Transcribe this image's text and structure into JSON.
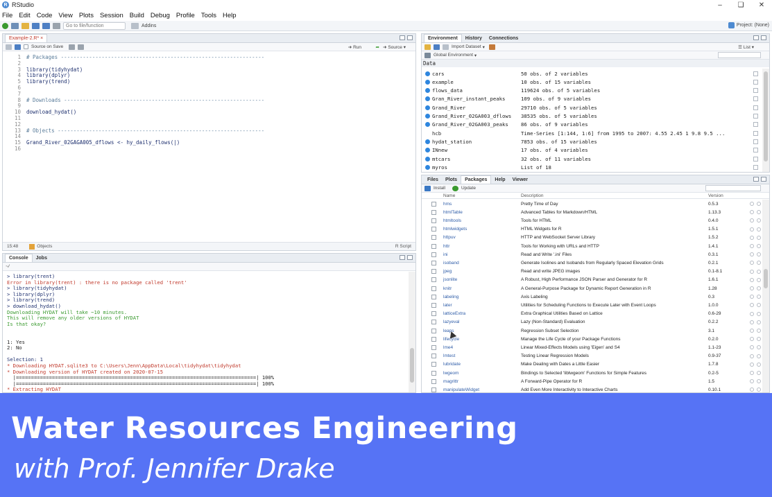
{
  "window": {
    "title": "RStudio",
    "app_initial": "R"
  },
  "menu": [
    "File",
    "Edit",
    "Code",
    "View",
    "Plots",
    "Session",
    "Build",
    "Debug",
    "Profile",
    "Tools",
    "Help"
  ],
  "toolbar": {
    "goto_placeholder": "Go to file/function",
    "addins": "Addins",
    "project": "Project: (None)"
  },
  "editor": {
    "tab": "Example-2.R*",
    "source_on_save": "Source on Save",
    "run": "Run",
    "source": "Source",
    "lines": [
      {
        "n": "1",
        "text": "# Packages -----------------------------------------------------------------",
        "kind": "comment"
      },
      {
        "n": "2",
        "text": "",
        "kind": "code"
      },
      {
        "n": "3",
        "text": "library(tidyhydat)",
        "kind": "code"
      },
      {
        "n": "4",
        "text": "library(dplyr)",
        "kind": "code"
      },
      {
        "n": "5",
        "text": "library(trend)",
        "kind": "code"
      },
      {
        "n": "6",
        "text": "",
        "kind": "code"
      },
      {
        "n": "7",
        "text": "",
        "kind": "code"
      },
      {
        "n": "8",
        "text": "# Downloads ----------------------------------------------------------------",
        "kind": "comment"
      },
      {
        "n": "9",
        "text": "",
        "kind": "code"
      },
      {
        "n": "10",
        "text": "download_hydat()",
        "kind": "code"
      },
      {
        "n": "11",
        "text": "",
        "kind": "code"
      },
      {
        "n": "12",
        "text": "",
        "kind": "code"
      },
      {
        "n": "13",
        "text": "# Objects ------------------------------------------------------------------",
        "kind": "comment"
      },
      {
        "n": "14",
        "text": "",
        "kind": "code"
      },
      {
        "n": "15",
        "text": "Grand_River_02GAGA005_dflows <- hy_daily_flows(|)",
        "kind": "code"
      },
      {
        "n": "16",
        "text": "",
        "kind": "code"
      }
    ],
    "status_pos": "15:48",
    "status_scope": "Objects",
    "status_type": "R Script"
  },
  "console": {
    "tabs": [
      "Console",
      "Jobs"
    ],
    "path": "~/",
    "lines": [
      {
        "text": "> library(trent)",
        "kind": "cmd"
      },
      {
        "text": "Error in library(trent) : there is no package called 'trent'",
        "kind": "err"
      },
      {
        "text": "> library(tidyhydat)",
        "kind": "cmd"
      },
      {
        "text": "> library(dplyr)",
        "kind": "cmd"
      },
      {
        "text": "> library(trend)",
        "kind": "cmd"
      },
      {
        "text": "> download_hydat()",
        "kind": "cmd"
      },
      {
        "text": "Downloading HYDAT will take ~10 minutes.",
        "kind": "msg"
      },
      {
        "text": "This will remove any older versions of HYDAT",
        "kind": "msg"
      },
      {
        "text": "Is that okay?",
        "kind": "msg"
      },
      {
        "text": "",
        "kind": "out"
      },
      {
        "text": "",
        "kind": "out"
      },
      {
        "text": "1: Yes",
        "kind": "out"
      },
      {
        "text": "2: No",
        "kind": "out"
      },
      {
        "text": "",
        "kind": "out"
      },
      {
        "text": "Selection: 1",
        "kind": "cmd"
      },
      {
        "text": "* Downloading HYDAT.sqlite3 to C:\\Users\\Jenn\\AppData\\Local\\tidyhydat\\tidyhydat",
        "kind": "info"
      },
      {
        "text": "* Downloading version of HYDAT created on 2020-07-15",
        "kind": "info"
      },
      {
        "text": "  |================================================================================| 100%",
        "kind": "out"
      },
      {
        "text": "  |================================================================================| 100%",
        "kind": "out"
      },
      {
        "text": "* Extracting HYDAT",
        "kind": "info"
      }
    ]
  },
  "environment": {
    "tabs": [
      "Environment",
      "History",
      "Connections"
    ],
    "import": "Import Dataset",
    "scope": "Global Environment",
    "list_view": "List",
    "section": "Data",
    "rows": [
      {
        "name": "cars",
        "value": "50 obs. of 2 variables",
        "icon": true
      },
      {
        "name": "example",
        "value": "10 obs. of 15 variables",
        "icon": true
      },
      {
        "name": "flows_data",
        "value": "119624 obs. of 5 variables",
        "icon": true
      },
      {
        "name": "Gran_River_instant_peaks",
        "value": "109 obs. of 9 variables",
        "icon": true
      },
      {
        "name": "Grand_River",
        "value": "29710 obs. of 5 variables",
        "icon": true
      },
      {
        "name": "Grand_River_02GA003_dflows",
        "value": "38535 obs. of 5 variables",
        "icon": true
      },
      {
        "name": "Grand_River_02GA003_peaks",
        "value": "86 obs. of 9 variables",
        "icon": true
      },
      {
        "name": "hcb",
        "value": "Time-Series [1:144, 1:6] from 1995 to 2007: 4.55 2.45 1 9.8 9.5 ...",
        "icon": false
      },
      {
        "name": "hydat_station",
        "value": "7853 obs. of 15 variables",
        "icon": true
      },
      {
        "name": "INnew",
        "value": "17 obs. of 4 variables",
        "icon": true
      },
      {
        "name": "mtcars",
        "value": "32 obs. of 11 variables",
        "icon": true
      },
      {
        "name": "myros",
        "value": "List of 18",
        "icon": true
      }
    ]
  },
  "packages": {
    "tabs": [
      "Files",
      "Plots",
      "Packages",
      "Help",
      "Viewer"
    ],
    "install": "Install",
    "update": "Update",
    "headers": {
      "name": "Name",
      "desc": "Description",
      "version": "Version"
    },
    "rows": [
      {
        "name": "hms",
        "desc": "Pretty Time of Day",
        "version": "0.5.3"
      },
      {
        "name": "htmlTable",
        "desc": "Advanced Tables for Markdown/HTML",
        "version": "1.13.3"
      },
      {
        "name": "htmltools",
        "desc": "Tools for HTML",
        "version": "0.4.0"
      },
      {
        "name": "htmlwidgets",
        "desc": "HTML Widgets for R",
        "version": "1.5.1"
      },
      {
        "name": "httpuv",
        "desc": "HTTP and WebSocket Server Library",
        "version": "1.5.2"
      },
      {
        "name": "httr",
        "desc": "Tools for Working with URLs and HTTP",
        "version": "1.4.1"
      },
      {
        "name": "ini",
        "desc": "Read and Write '.ini' Files",
        "version": "0.3.1"
      },
      {
        "name": "isoband",
        "desc": "Generate Isolines and Isobands from Regularly Spaced Elevation Grids",
        "version": "0.2.1"
      },
      {
        "name": "jpeg",
        "desc": "Read and write JPEG images",
        "version": "0.1-8.1"
      },
      {
        "name": "jsonlite",
        "desc": "A Robust, High Performance JSON Parser and Generator for R",
        "version": "1.6.1"
      },
      {
        "name": "knitr",
        "desc": "A General-Purpose Package for Dynamic Report Generation in R",
        "version": "1.28"
      },
      {
        "name": "labeling",
        "desc": "Axis Labeling",
        "version": "0.3"
      },
      {
        "name": "later",
        "desc": "Utilities for Scheduling Functions to Execute Later with Event Loops",
        "version": "1.0.0"
      },
      {
        "name": "latticeExtra",
        "desc": "Extra Graphical Utilities Based on Lattice",
        "version": "0.6-29"
      },
      {
        "name": "lazyeval",
        "desc": "Lazy (Non-Standard) Evaluation",
        "version": "0.2.2"
      },
      {
        "name": "leaps",
        "desc": "Regression Subset Selection",
        "version": "3.1"
      },
      {
        "name": "lifecycle",
        "desc": "Manage the Life Cycle of your Package Functions",
        "version": "0.2.0"
      },
      {
        "name": "lme4",
        "desc": "Linear Mixed-Effects Models using 'Eigen' and S4",
        "version": "1.1-23"
      },
      {
        "name": "lmtest",
        "desc": "Testing Linear Regression Models",
        "version": "0.9-37"
      },
      {
        "name": "lubridate",
        "desc": "Make Dealing with Dates a Little Easier",
        "version": "1.7.8"
      },
      {
        "name": "lwgeom",
        "desc": "Bindings to Selected 'liblwgeom' Functions for Simple Features",
        "version": "0.2-5"
      },
      {
        "name": "magrittr",
        "desc": "A Forward-Pipe Operator for R",
        "version": "1.5"
      },
      {
        "name": "manipulateWidget",
        "desc": "Add Even More Interactivity to Interactive Charts",
        "version": "0.10.1"
      }
    ]
  },
  "banner": {
    "title": "Water Resources Engineering",
    "subtitle": "with Prof. Jennifer Drake",
    "bg_color": "#5673f5"
  }
}
